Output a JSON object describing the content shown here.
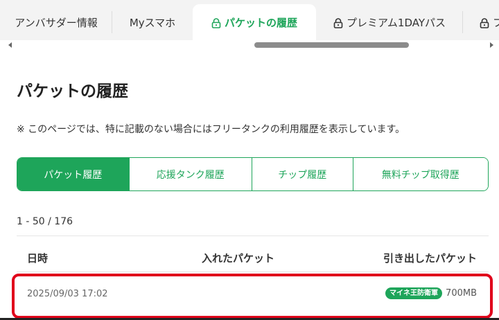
{
  "tabs": [
    {
      "label": "アンバサダー情報",
      "lock": false,
      "active": false
    },
    {
      "label": "Myスマホ",
      "lock": false,
      "active": false
    },
    {
      "label": "パケットの履歴",
      "lock": true,
      "active": true
    },
    {
      "label": "プレミアム1DAYパス",
      "lock": true,
      "active": false
    },
    {
      "label": "フ",
      "lock": true,
      "active": false
    }
  ],
  "page_title": "パケットの履歴",
  "note": "※ このページでは、特に記載のない場合にはフリータンクの利用履歴を表示しています。",
  "segments": [
    {
      "label": "パケット履歴",
      "active": true
    },
    {
      "label": "応援タンク履歴",
      "active": false
    },
    {
      "label": "チップ履歴",
      "active": false
    },
    {
      "label": "無料チップ取得歴",
      "active": false
    }
  ],
  "count": "1 - 50 / 176",
  "table": {
    "headers": {
      "date": "日時",
      "in": "入れたパケット",
      "out": "引き出したパケット"
    },
    "rows": [
      {
        "date": "2025/09/03 17:02",
        "in": "",
        "badge": "マイネ王防衛軍",
        "amount": "700MB"
      }
    ]
  },
  "colors": {
    "accent": "#1ea55a",
    "highlight": "#e0001b"
  },
  "icons": {
    "lock": "lock-icon",
    "scroll_left": "arrow-left-icon",
    "scroll_right": "arrow-right-icon"
  }
}
